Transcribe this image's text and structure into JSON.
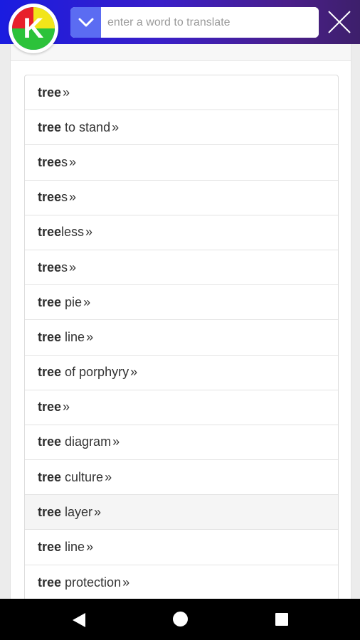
{
  "app": {
    "logo_letter": "K",
    "colors": {
      "topbar_start": "#1a1ce0",
      "topbar_end": "#3d1f6b",
      "dropdown_bg": "#5b6cf2",
      "logo_red": "#e8202a",
      "logo_yellow": "#f2e51a",
      "logo_green": "#2cc23a",
      "logo_blue": "#2d6be0"
    }
  },
  "search": {
    "placeholder": "enter a word to translate",
    "value": "",
    "dropdown_icon": "chevron-down-icon",
    "close_icon": "close-icon"
  },
  "results": {
    "items": [
      {
        "bold": "tree",
        "rest": "",
        "arrow": "»",
        "highlighted": false
      },
      {
        "bold": "tree",
        "rest": " to stand",
        "arrow": "»",
        "highlighted": false
      },
      {
        "bold": "tree",
        "rest": "s",
        "arrow": "»",
        "highlighted": false
      },
      {
        "bold": "tree",
        "rest": "s",
        "arrow": "»",
        "highlighted": false
      },
      {
        "bold": "tree",
        "rest": "less",
        "arrow": "»",
        "highlighted": false
      },
      {
        "bold": "tree",
        "rest": "s",
        "arrow": "»",
        "highlighted": false
      },
      {
        "bold": "tree",
        "rest": " pie",
        "arrow": "»",
        "highlighted": false
      },
      {
        "bold": "tree",
        "rest": " line",
        "arrow": "»",
        "highlighted": false
      },
      {
        "bold": "tree",
        "rest": " of porphyry",
        "arrow": "»",
        "highlighted": false
      },
      {
        "bold": "tree",
        "rest": "",
        "arrow": "»",
        "highlighted": false
      },
      {
        "bold": "tree",
        "rest": " diagram",
        "arrow": "»",
        "highlighted": false
      },
      {
        "bold": "tree",
        "rest": " culture",
        "arrow": "»",
        "highlighted": false
      },
      {
        "bold": "tree",
        "rest": " layer",
        "arrow": "»",
        "highlighted": true
      },
      {
        "bold": "tree",
        "rest": " line",
        "arrow": "»",
        "highlighted": false
      },
      {
        "bold": "tree",
        "rest": " protection",
        "arrow": "»",
        "highlighted": false
      }
    ]
  },
  "navbar": {
    "back_icon": "back-triangle-icon",
    "home_icon": "home-circle-icon",
    "recent_icon": "recent-apps-icon"
  }
}
